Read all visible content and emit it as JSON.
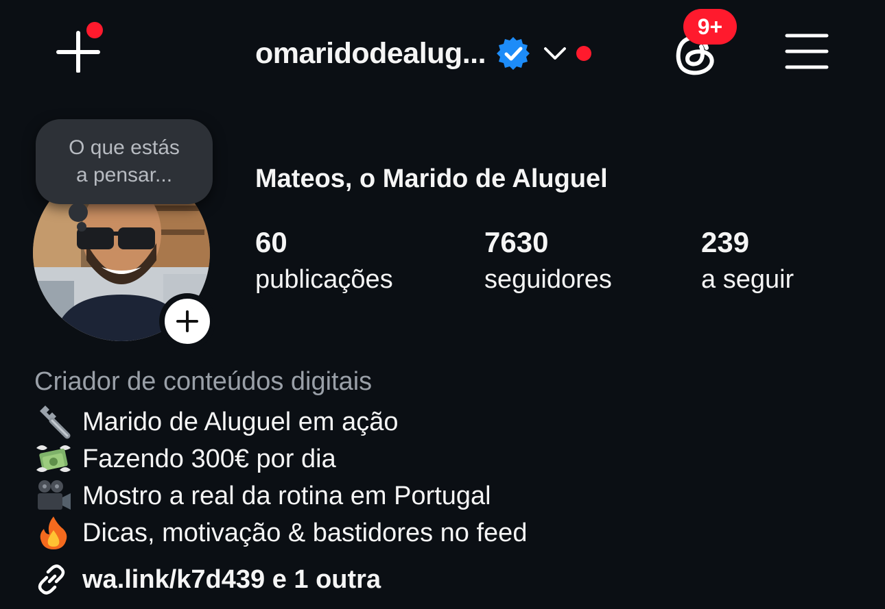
{
  "header": {
    "username": "omaridodealug...",
    "notification_badge": "9+",
    "accent_color": "#ff1a2d",
    "verified_color": "#1d8cf8"
  },
  "profile": {
    "note_placeholder_line1": "O que estás",
    "note_placeholder_line2": "a pensar...",
    "display_name": "Mateos, o Marido de Aluguel",
    "stats": [
      {
        "number": "60",
        "label": "publicações"
      },
      {
        "number": "7630",
        "label": "seguidores"
      },
      {
        "number": "239",
        "label": "a seguir"
      }
    ]
  },
  "bio": {
    "category": "Criador de conteúdos digitais",
    "lines": [
      {
        "icon": "wrench-icon",
        "text": "Marido de Aluguel em ação"
      },
      {
        "icon": "money-wings-icon",
        "text": "Fazendo 300€ por dia"
      },
      {
        "icon": "movie-camera-icon",
        "text": "Mostro a real da rotina em Portugal"
      },
      {
        "icon": "fire-icon",
        "text": "Dicas, motivação & bastidores no feed"
      }
    ],
    "link_text": "wa.link/k7d439 e 1 outra"
  }
}
